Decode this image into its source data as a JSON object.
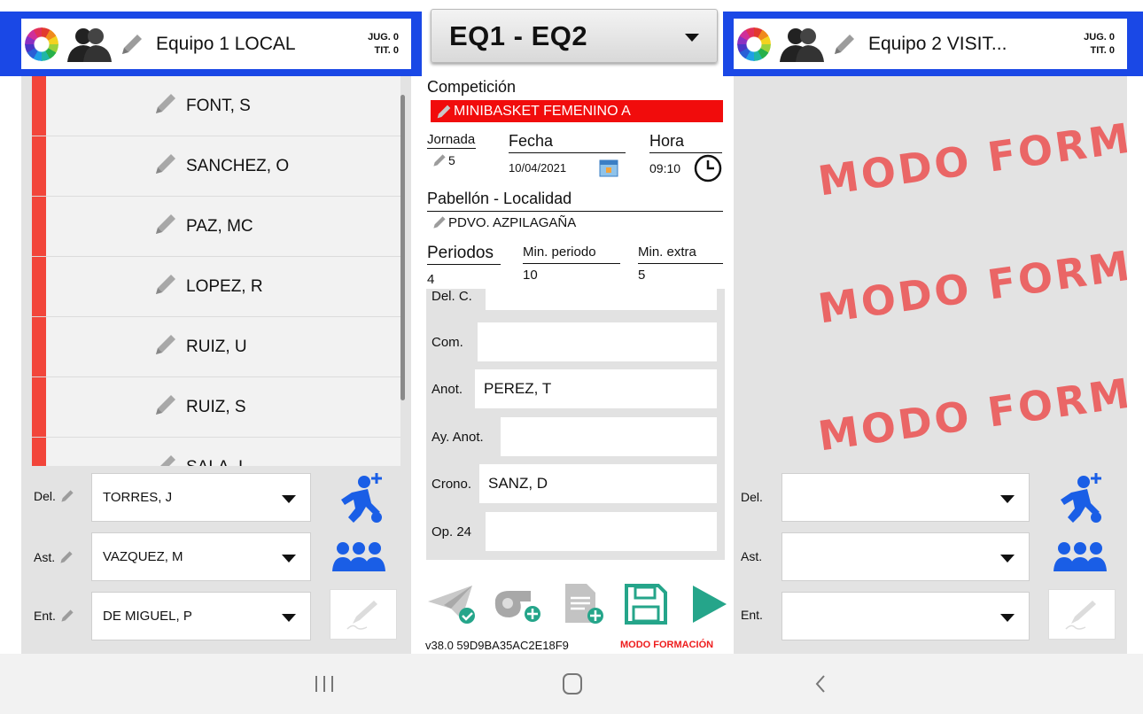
{
  "home_team": {
    "name": "Equipo 1 LOCAL",
    "jug": "JUG. 0",
    "tit": "TIT. 0",
    "players": [
      "FONT, S",
      "SANCHEZ, O",
      "PAZ, MC",
      "LOPEZ, R",
      "RUIZ, U",
      "RUIZ, S",
      "SALA, L"
    ],
    "staff": [
      {
        "label": "Del.",
        "value": "TORRES, J"
      },
      {
        "label": "Ast.",
        "value": "VAZQUEZ, M"
      },
      {
        "label": "Ent.",
        "value": "DE MIGUEL, P"
      }
    ]
  },
  "away_team": {
    "name": "Equipo 2 VISIT...",
    "jug": "JUG. 0",
    "tit": "TIT. 0",
    "watermark": "MODO FORMA",
    "staff": [
      {
        "label": "Del.",
        "value": ""
      },
      {
        "label": "Ast.",
        "value": ""
      },
      {
        "label": "Ent.",
        "value": ""
      }
    ]
  },
  "match": {
    "selector": "EQ1 - EQ2",
    "competicion_label": "Competición",
    "competicion": "MINIBASKET FEMENINO A",
    "jornada_label": "Jornada",
    "jornada": "5",
    "fecha_label": "Fecha",
    "fecha": "10/04/2021",
    "hora_label": "Hora",
    "hora": "09:10",
    "pabellon_label": "Pabellón - Localidad",
    "pabellon": "PDVO. AZPILAGAÑA",
    "periodos_label": "Periodos",
    "periodos": "4",
    "min_periodo_label": "Min. periodo",
    "min_periodo": "10",
    "min_extra_label": "Min. extra",
    "min_extra": "5"
  },
  "officials": [
    {
      "label": "Del. C.",
      "value": ""
    },
    {
      "label": "Com.",
      "value": ""
    },
    {
      "label": "Anot.",
      "value": "PEREZ, T"
    },
    {
      "label": "Ay. Anot.",
      "value": ""
    },
    {
      "label": "Crono.",
      "value": "SANZ, D"
    },
    {
      "label": "Op. 24",
      "value": ""
    }
  ],
  "footer": {
    "version": "v38.0 59D9BA35AC2E18F9",
    "mode": "MODO FORMACIÓN"
  },
  "colors": {
    "accent_blue": "#1a48e6",
    "player_stripe": "#f2453a",
    "competition_red": "#f10c0c",
    "play_green": "#25a58a",
    "icon_blue": "#1a5ee6"
  }
}
